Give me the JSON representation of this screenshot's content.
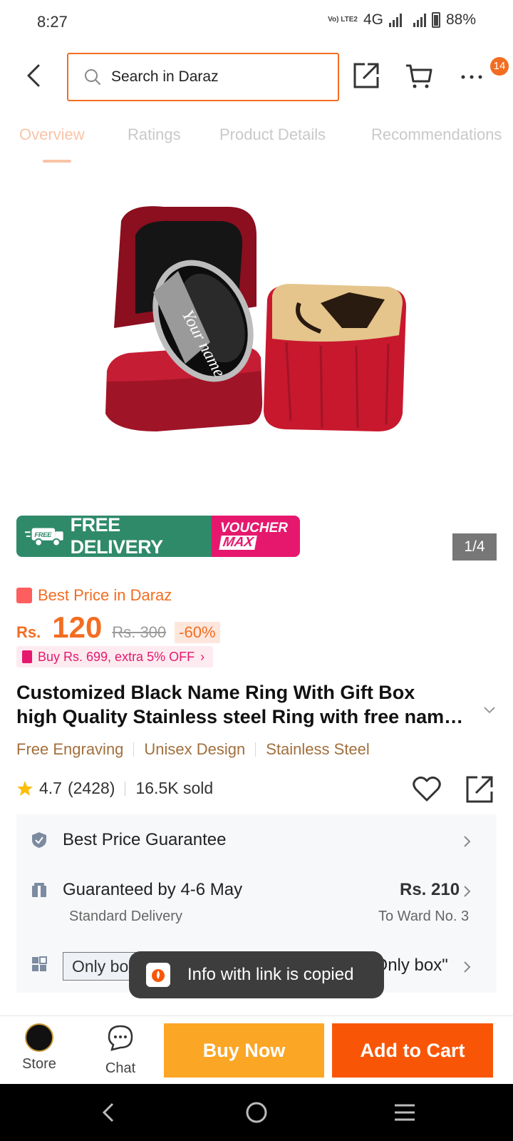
{
  "status_bar": {
    "time": "8:27",
    "volte": "Vo) LTE2",
    "network": "4G",
    "battery": "88%"
  },
  "header": {
    "search_placeholder": "Search in Daraz",
    "cart_badge": "14"
  },
  "tabs": [
    "Overview",
    "Ratings",
    "Product Details",
    "Recommendations"
  ],
  "gallery": {
    "counter": "1/4",
    "engraving_text": "Your name"
  },
  "promo_banner": {
    "free_delivery": "FREE DELIVERY",
    "free_tag": "FREE",
    "voucher": "VOUCHER",
    "max": "MAX"
  },
  "pricing": {
    "best_price_label": "Best Price in Daraz",
    "currency": "Rs.",
    "price": "120",
    "original_price": "Rs. 300",
    "discount": "-60%",
    "promo": "Buy Rs. 699, extra 5% OFF"
  },
  "product": {
    "title_line1": "Customized Black Name Ring With Gift Box",
    "title_line2": "high Quality Stainless steel Ring with free name engraving",
    "features": [
      "Free Engraving",
      "Unisex Design",
      "Stainless Steel"
    ],
    "rating": "4.7",
    "review_count": "(2428)",
    "sold": "16.5K sold"
  },
  "info_panel": {
    "guarantee": "Best Price Guarantee",
    "delivery_title": "Guaranteed by 4-6 May",
    "delivery_type": "Standard Delivery",
    "delivery_fee": "Rs. 210",
    "delivery_to": "To Ward No. 3",
    "variant_option": "Only box",
    "variant_selected": "\"Only box\""
  },
  "toast": {
    "message": "Info with link is copied"
  },
  "bottom_bar": {
    "store": "Store",
    "chat": "Chat",
    "buy_now": "Buy Now",
    "add_to_cart": "Add to Cart"
  },
  "colors": {
    "brand_orange": "#f85606",
    "buy_now": "#fca626",
    "free_delivery_green": "#2f8a6a",
    "voucher_pink": "#e5186e"
  }
}
